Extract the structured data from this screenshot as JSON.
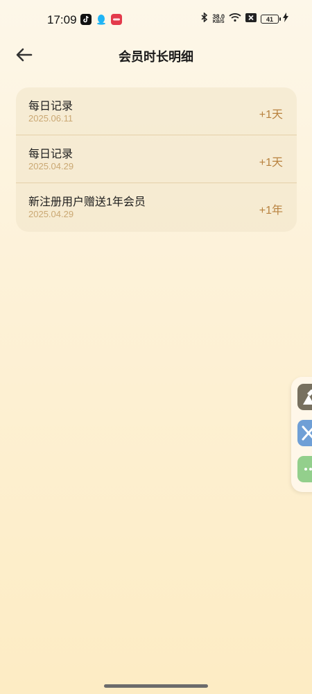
{
  "status_bar": {
    "time": "17:09",
    "net_speed_value": "38.0",
    "net_speed_unit": "KB/S",
    "battery_level": "41",
    "icons": [
      "tiktok-icon",
      "qq-icon",
      "red-app-icon",
      "bluetooth-icon",
      "wifi-icon",
      "sim-off-icon",
      "battery-icon",
      "charging-icon"
    ]
  },
  "header": {
    "title": "会员时长明细",
    "back_icon": "arrow-left-icon"
  },
  "records": [
    {
      "name": "每日记录",
      "date": "2025.06.11",
      "value": "+1天"
    },
    {
      "name": "每日记录",
      "date": "2025.04.29",
      "value": "+1天"
    },
    {
      "name": "新注册用户赠送1年会员",
      "date": "2025.04.29",
      "value": "+1年"
    }
  ],
  "side_dock": {
    "items": [
      "assistant-icon",
      "tools-icon",
      "more-icon"
    ]
  },
  "colors": {
    "accent": "#b8823f",
    "date_text": "#caa873",
    "background_top": "#fdf7e9",
    "background_bottom": "#fdecc4"
  }
}
